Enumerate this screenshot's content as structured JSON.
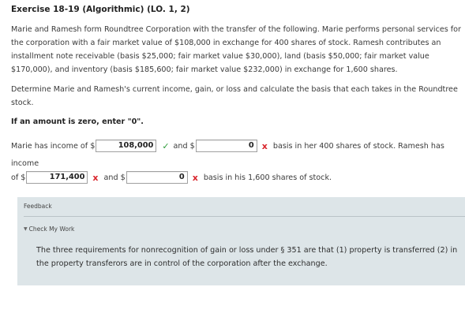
{
  "exercise": {
    "title": "Exercise 18-19 (Algorithmic) (LO. 1, 2)",
    "paragraph1": "Marie and Ramesh form Roundtree Corporation with the transfer of the following. Marie performs personal services for the corporation with a fair market value of $108,000 in exchange for 400 shares of stock. Ramesh contributes an installment note receivable (basis $25,000; fair market value $30,000), land (basis $50,000; fair market value $170,000), and inventory (basis $185,600; fair market value $232,000) in exchange for 1,600 shares.",
    "paragraph2": "Determine Marie and Ramesh's current income, gain, or loss and calculate the basis that each takes in the Roundtree stock.",
    "instruction": "If an amount is zero, enter \"0\"."
  },
  "answers": {
    "row1_prefix": "Marie has income of $",
    "marie_income_value": "108,000",
    "marie_income_status": "correct",
    "and_label_1": "and $",
    "marie_basis_value": "0",
    "marie_basis_status": "incorrect",
    "row1_suffix": "basis in her 400 shares of stock. Ramesh has",
    "row2_text": "income",
    "row3_prefix": "of $",
    "ramesh_income_value": "171,400",
    "ramesh_income_status": "incorrect",
    "and_label_2": "and $",
    "ramesh_basis_value": "0",
    "ramesh_basis_status": "incorrect",
    "row3_suffix": "basis in his 1,600 shares of stock.",
    "check_glyph": "✓",
    "cross_glyph": "x"
  },
  "feedback": {
    "label": "Feedback",
    "check_my_work": "Check My Work",
    "text": "The three requirements for nonrecognition of gain or loss under § 351 are that (1) property is transferred (2) in the property transferors are in control of the corporation after the exchange."
  },
  "colors": {
    "correct": "#2e9b3a",
    "incorrect": "#d9262d",
    "feedback_bg": "#dde5e8"
  }
}
